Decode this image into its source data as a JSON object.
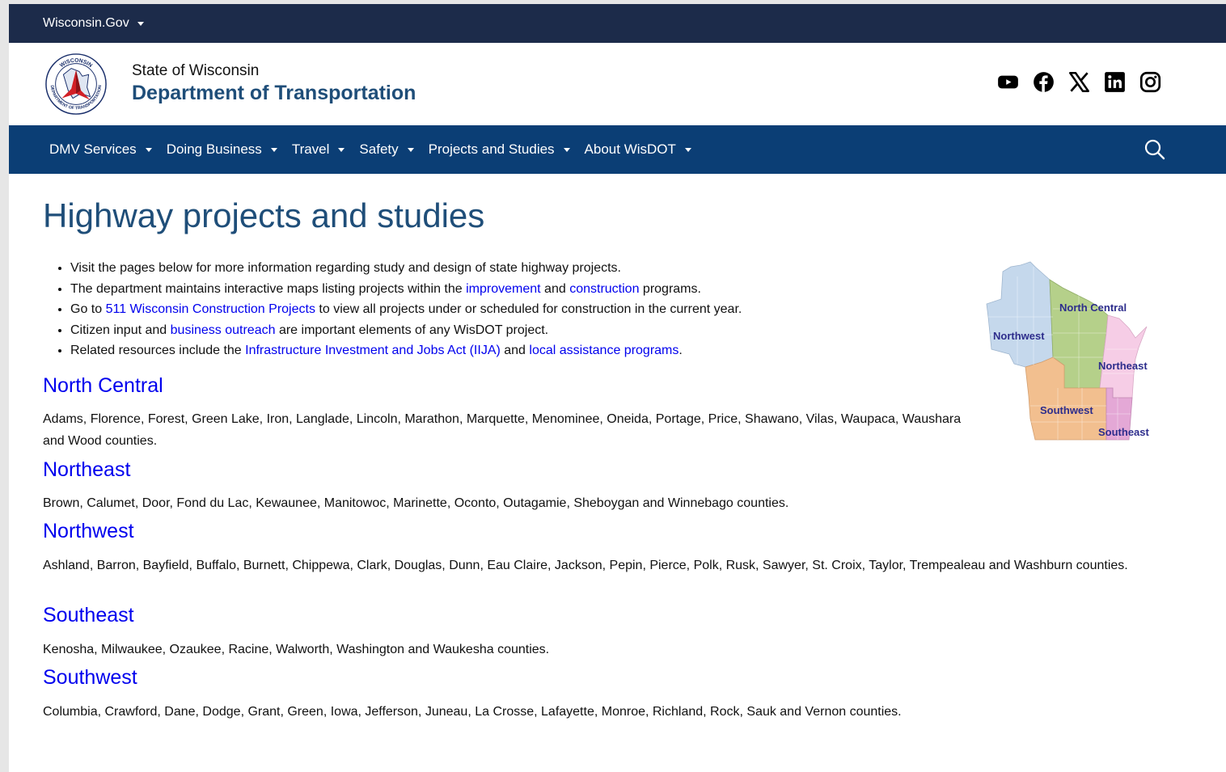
{
  "topbar": {
    "gov_label": "Wisconsin.Gov"
  },
  "brand": {
    "logo_ring_text_top": "WISCONSIN",
    "logo_ring_text_bottom": "DEPARTMENT OF TRANSPORTATION",
    "subtitle": "State of Wisconsin",
    "title": "Department of Transportation"
  },
  "social": [
    "youtube-icon",
    "facebook-icon",
    "x-icon",
    "linkedin-icon",
    "instagram-icon"
  ],
  "nav": {
    "items": [
      {
        "label": "DMV Services"
      },
      {
        "label": "Doing Business"
      },
      {
        "label": "Travel"
      },
      {
        "label": "Safety"
      },
      {
        "label": "Projects and Studies"
      },
      {
        "label": "About WisDOT"
      }
    ]
  },
  "colors": {
    "govbar": "#1c2b4a",
    "nav": "#0b3e75",
    "title": "#1f4e79",
    "link": "#0000ee"
  },
  "main": {
    "title": "Highway projects and studies",
    "bullets": {
      "b1": "Visit the pages below for more information regarding study and design of state highway projects.",
      "b2_pre": "The department maintains interactive maps listing projects within the ",
      "b2_link1": "improvement",
      "b2_mid": " and ",
      "b2_link2": "construction",
      "b2_post": " programs.",
      "b3_pre": "Go to ",
      "b3_link": "511 Wisconsin Construction Projects",
      "b3_post": " to view all projects under or scheduled for construction in the current year.",
      "b4_pre": "Citizen input and ",
      "b4_link": "business outreach",
      "b4_post": " are important elements of any WisDOT project.",
      "b5_pre": "Related resources include the ",
      "b5_link1": "Infrastructure Investment and Jobs Act (IIJA)",
      "b5_mid": " and ",
      "b5_link2": "local assistance programs",
      "b5_post": "."
    },
    "regions": [
      {
        "name": "North Central",
        "counties": "Adams, Florence, Forest, Green Lake, Iron, Langlade, Lincoln, Marathon, Marquette, Menominee, Oneida, Portage, Price, Shawano, Vilas, Waupaca, Waushara and Wood counties."
      },
      {
        "name": "Northeast",
        "counties": "Brown, Calumet, Door, Fond du Lac, Kewaunee, Manitowoc, Marinette, Oconto, Outagamie, Sheboygan and Winnebago counties."
      },
      {
        "name": "Northwest",
        "counties": "Ashland, Barron, Bayfield, Buffalo, Burnett, Chippewa, Clark, Douglas, Dunn, Eau Claire, Jackson, Pepin, Pierce, Polk, Rusk, Sawyer, St. Croix, Taylor, Trempealeau and Washburn counties."
      },
      {
        "name": "Southeast",
        "counties": "Kenosha, Milwaukee, Ozaukee, Racine, Walworth, Washington and Waukesha counties."
      },
      {
        "name": "Southwest",
        "counties": "Columbia, Crawford, Dane, Dodge, Grant, Green, Iowa, Jefferson, Juneau, La Crosse, Lafayette, Monroe, Richland, Rock, Sauk and Vernon counties."
      }
    ]
  },
  "map": {
    "labels": [
      "North Central",
      "Northwest",
      "Northeast",
      "Southwest",
      "Southeast"
    ],
    "colors": {
      "northwest": "#c5d8ec",
      "north_central": "#b5d08a",
      "northeast": "#f6cde6",
      "southwest": "#f2bf8f",
      "southeast": "#e4a8d6"
    }
  }
}
